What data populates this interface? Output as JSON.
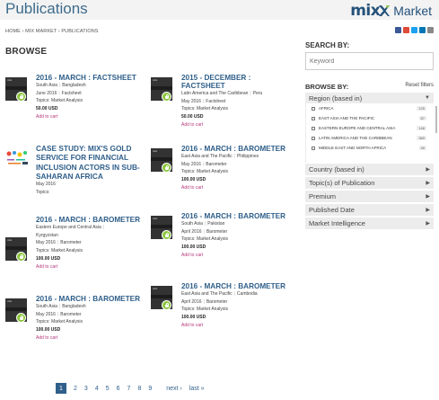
{
  "header": {
    "title": "Publications",
    "logo_text": "mix",
    "logo_market": "Market",
    "brand_color": "#24517a",
    "accent_green": "#8dc63f"
  },
  "breadcrumb": "HOME  ›  MIX MARKET  ›  PUBLICATIONS",
  "share_icons": [
    "facebook-icon",
    "googleplus-icon",
    "twitter-icon",
    "linkedin-icon",
    "email-icon"
  ],
  "browse": {
    "title": "BROWSE",
    "items": [
      {
        "title": "2016 - MARCH : FACTSHEET",
        "region": "South Asia",
        "country": "Bangladesh",
        "date": "June 2016",
        "type": "Factsheet",
        "topics": "Topics: Market Analysis",
        "price": "50.00 USD",
        "cart": "Add to cart"
      },
      {
        "title": "2015 - DECEMBER : FACTSHEET",
        "region": "Latin America and The Caribbean",
        "country": "Peru",
        "date": "May 2016",
        "type": "Factsheet",
        "topics": "Topics: Market Analysis",
        "price": "50.00 USD",
        "cart": "Add to cart"
      },
      {
        "title": "CASE STUDY: MIX'S GOLD SERVICE FOR FINANCIAL INCLUSION ACTORS IN SUB-SAHARAN AFRICA",
        "date": "May 2016",
        "topics": "Topics:"
      },
      {
        "title": "2016 - MARCH : BAROMETER",
        "region": "East Asia and The Pacific",
        "country": "Philippines",
        "date": "May 2016",
        "type": "Barometer",
        "topics": "Topics: Market Analysis",
        "price": "100.00 USD",
        "cart": "Add to cart"
      },
      {
        "title": "2016 - MARCH : BAROMETER",
        "region": "Eastern Europe and Central Asia",
        "country": "Kyrgyzstan",
        "date": "May 2016",
        "type": "Barometer",
        "topics": "Topics: Market Analysis",
        "price": "100.00 USD",
        "cart": "Add to cart"
      },
      {
        "title": "2016 - MARCH : BAROMETER",
        "region": "South Asia",
        "country": "Pakistan",
        "date": "April 2016",
        "type": "Barometer",
        "topics": "Topics: Market Analysis",
        "price": "100.00 USD",
        "cart": "Add to cart"
      },
      {
        "title": "2016 - MARCH : BAROMETER",
        "region": "South Asia",
        "country": "Bangladesh",
        "date": "May 2016",
        "type": "Barometer",
        "topics": "Topics: Market Analysis",
        "price": "100.00 USD",
        "cart": "Add to cart"
      },
      {
        "title": "2016 - MARCH : BAROMETER",
        "region": "East Asia and The Pacific",
        "country": "Cambodia",
        "date": "April 2016",
        "type": "Barometer",
        "topics": "Topics: Market Analysis",
        "price": "100.00 USD",
        "cart": "Add to cart"
      }
    ]
  },
  "search": {
    "heading": "SEARCH BY:",
    "placeholder": "Keyword"
  },
  "filters": {
    "heading": "BROWSE BY:",
    "reset": "Reset filters",
    "region_label": "Region (based in)",
    "regions": [
      {
        "name": "AFRICA",
        "count": "125"
      },
      {
        "name": "EAST ASIA AND THE PACIFIC",
        "count": "87"
      },
      {
        "name": "EASTERN EUROPE AND CENTRAL ASIA",
        "count": "148"
      },
      {
        "name": "LATIN AMERICA AND THE CARIBBEAN",
        "count": "369"
      },
      {
        "name": "MIDDLE EAST AND NORTH AFRICA",
        "count": "45"
      }
    ],
    "facets": [
      "Country (based in)",
      "Topic(s) of Publication",
      "Premium",
      "Published Date",
      "Market Intelligence"
    ]
  },
  "pager": {
    "current": "1",
    "pages": [
      "2",
      "3",
      "4",
      "5",
      "6",
      "7",
      "8",
      "9"
    ],
    "next": "next ›",
    "last": "last »"
  }
}
